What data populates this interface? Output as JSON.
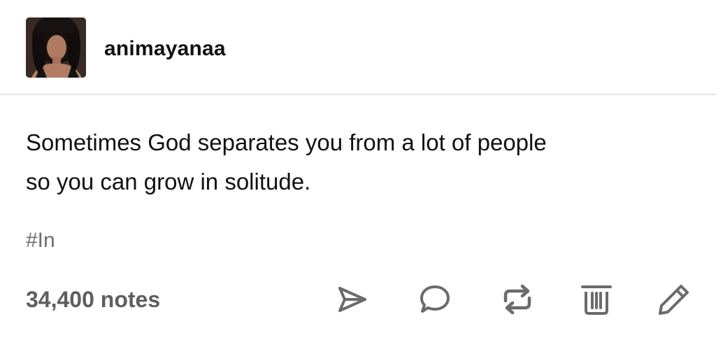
{
  "post": {
    "author": {
      "username": "animayanaa",
      "avatar_icon": "avatar-photo"
    },
    "content": {
      "line1": "Sometimes God separates you from a lot of people",
      "line2": "so you can grow in solitude."
    },
    "tags": [
      "#In"
    ],
    "footer": {
      "notes": "34,400 notes",
      "actions": [
        "share-icon",
        "reply-icon",
        "reblog-icon",
        "delete-icon",
        "edit-icon"
      ]
    }
  },
  "colors": {
    "text": "#111111",
    "muted": "#5e5e5e",
    "tag": "#6e6e6e",
    "divider": "#e6e6e6"
  }
}
